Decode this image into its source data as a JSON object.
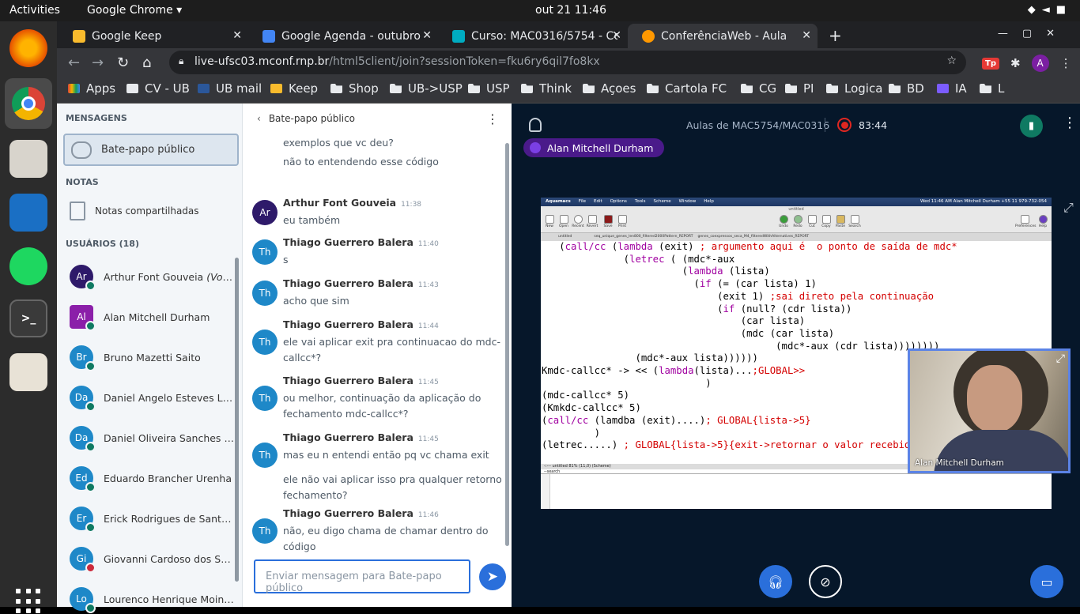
{
  "system_bar": {
    "activities": "Activities",
    "app_menu": "Google Chrome ▾",
    "clock": "out 21  11:46"
  },
  "browser": {
    "tabs": [
      {
        "title": "Google Keep",
        "color": "#f9bb2d"
      },
      {
        "title": "Google Agenda - outubro",
        "color": "#4285f4"
      },
      {
        "title": "Curso: MAC0316/5754 - Co",
        "color": "#00acc1"
      },
      {
        "title": "ConferênciaWeb - Aula",
        "color": "#ff9800"
      }
    ],
    "url_host": "live-ufsc03.mconf.rnp.br",
    "url_path": "/html5client/join?sessionToken=fku6ry6qil7fo8kx",
    "profile_initial": "A",
    "bookmarks": [
      "Apps",
      "CV - UB",
      "UB mail",
      "Keep",
      "Shop",
      "UB->USP",
      "USP",
      "Think",
      "Açoes",
      "Cartola FC",
      "CG",
      "PI",
      "Logica",
      "BD",
      "IA",
      "L"
    ]
  },
  "sidebar": {
    "messages_heading": "MENSAGENS",
    "public_chat": "Bate-papo público",
    "notes_heading": "NOTAS",
    "shared_notes": "Notas compartilhadas",
    "users_heading": "USUÁRIOS (18)",
    "users": [
      {
        "initials": "Ar",
        "name": "Arthur Font Gouveia",
        "suffix": "(Você)",
        "color": "#2e1a6a",
        "mic": "on"
      },
      {
        "initials": "Al",
        "name": "Alan Mitchell Durham",
        "suffix": "",
        "color": "#8b1fa9",
        "mic": "on"
      },
      {
        "initials": "Br",
        "name": "Bruno Mazetti Saito",
        "suffix": "",
        "color": "#1e88c8",
        "mic": "on"
      },
      {
        "initials": "Da",
        "name": "Daniel Angelo Esteves Lawand",
        "suffix": "",
        "color": "#1e88c8",
        "mic": "on"
      },
      {
        "initials": "Da",
        "name": "Daniel Oliveira Sanches Leal",
        "suffix": "",
        "color": "#1e88c8",
        "mic": "on"
      },
      {
        "initials": "Ed",
        "name": "Eduardo Brancher Urenha",
        "suffix": "",
        "color": "#1e88c8",
        "mic": "on"
      },
      {
        "initials": "Er",
        "name": "Erick Rodrigues de Santana",
        "suffix": "",
        "color": "#1e88c8",
        "mic": "on"
      },
      {
        "initials": "Gi",
        "name": "Giovanni Cardoso dos Santos...",
        "suffix": "",
        "color": "#1e88c8",
        "mic": "off"
      },
      {
        "initials": "Lo",
        "name": "Lourenco Henrique Moinheir...",
        "suffix": "",
        "color": "#1e88c8",
        "mic": "on"
      }
    ]
  },
  "chat": {
    "header": "Bate-papo público",
    "top_fragments": [
      "exemplos que vc deu?",
      "não to entendendo esse código"
    ],
    "messages": [
      {
        "initials": "Ar",
        "color": "#2e1a6a",
        "author": "Arthur Font Gouveia",
        "time": "11:38",
        "lines": [
          "eu também"
        ]
      },
      {
        "initials": "Th",
        "color": "#1e88c8",
        "author": "Thiago Guerrero Balera",
        "time": "11:40",
        "lines": [
          "s"
        ]
      },
      {
        "initials": "Th",
        "color": "#1e88c8",
        "author": "Thiago Guerrero Balera",
        "time": "11:43",
        "lines": [
          "acho que sim"
        ]
      },
      {
        "initials": "Th",
        "color": "#1e88c8",
        "author": "Thiago Guerrero Balera",
        "time": "11:44",
        "lines": [
          "ele vai aplicar exit pra continuacao do mdc-",
          "callcc*?"
        ]
      },
      {
        "initials": "Th",
        "color": "#1e88c8",
        "author": "Thiago Guerrero Balera",
        "time": "11:45",
        "lines": [
          "ou melhor, continuação da aplicação do",
          "fechamento mdc-callcc*?"
        ]
      },
      {
        "initials": "Th",
        "color": "#1e88c8",
        "author": "Thiago Guerrero Balera",
        "time": "11:45",
        "lines": [
          "mas eu n entendi então pq vc chama exit",
          "",
          "ele não vai aplicar isso pra qualquer retorno do",
          "fechamento?"
        ]
      },
      {
        "initials": "Th",
        "color": "#1e88c8",
        "author": "Thiago Guerrero Balera",
        "time": "11:46",
        "lines": [
          "não, eu digo chama de chamar dentro do",
          "código"
        ]
      }
    ],
    "input_placeholder": "Enviar mensagem para Bate-papo público"
  },
  "conference": {
    "title": "Aulas de MAC5754/MAC0316",
    "recording_time": "83:44",
    "talking_user": "Alan Mitchell Durham",
    "webcam_name": "Alan Mitchell Durham",
    "shared_screen": {
      "menubar": [
        "Aquamacs",
        "File",
        "Edit",
        "Options",
        "Tools",
        "Scheme",
        "Window",
        "Help"
      ],
      "menubar_right": "Wed 11:46 AM   Alan Mitchell Durham +55 11 979-732-054",
      "window_title": "untitled",
      "toolbar": [
        "New",
        "Open",
        "Recent",
        "Revert",
        "Save",
        "Print",
        "Undo",
        "Redo",
        "Cut",
        "Copy",
        "Paste",
        "Search",
        "Preferences",
        "Help"
      ],
      "buffer_tabs": [
        "untitled",
        "seq_unique_genes_len800_filtered2000Pattern_REPORT",
        "genes_coexpressos_seca_M4_filteredWithAlternatives_REPORT"
      ],
      "modeline": "-:--- untitled        81% (11,0)    (Scheme)",
      "minibuffer": "--search"
    }
  }
}
